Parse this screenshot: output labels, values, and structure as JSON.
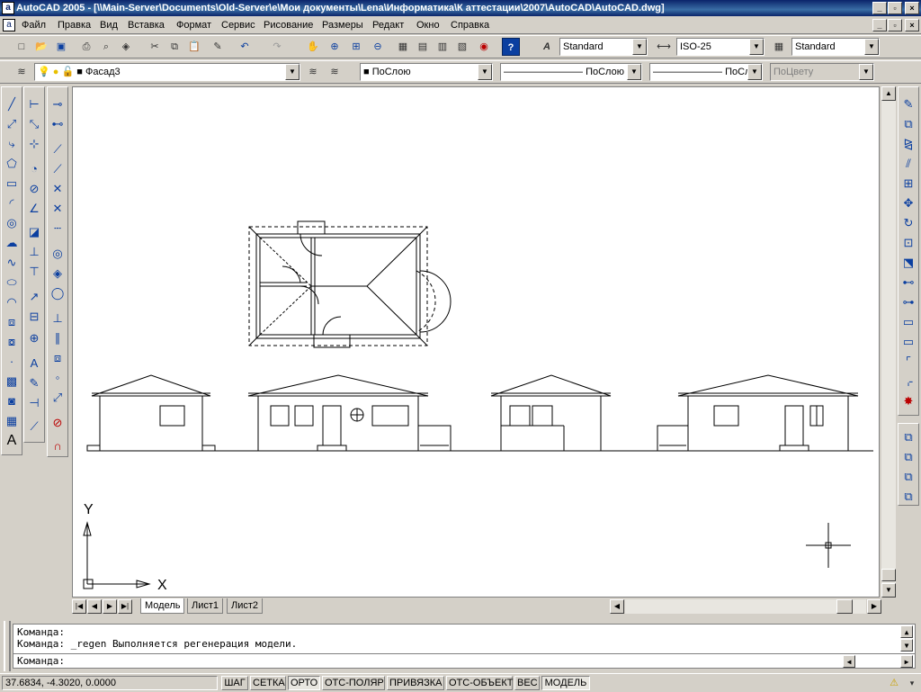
{
  "window": {
    "title": "AutoCAD 2005 - [\\\\Main-Server\\Documents\\Old-Server\\e\\Мои документы\\Lena\\Информатика\\К аттестации\\2007\\AutoCAD\\AutoCAD.dwg]",
    "app_icon": "autocad-icon"
  },
  "menu": [
    "Файл",
    "Правка",
    "Вид",
    "Вставка",
    "Формат",
    "Сервис",
    "Рисование",
    "Размеры",
    "Редакт",
    "Окно",
    "Справка"
  ],
  "toolbar": {
    "text_style": "Standard",
    "dim_style": "ISO-25",
    "table_style": "Standard",
    "layer": "Фасад3",
    "color": "ПоСлою",
    "linetype": "ПоСлою",
    "lineweight": "ПоСлою",
    "plotstyle": "ПоЦвету"
  },
  "canvas": {
    "ucs_x": "X",
    "ucs_y": "Y"
  },
  "tabs": [
    "Модель",
    "Лист1",
    "Лист2"
  ],
  "command": {
    "line1": "Команда:",
    "line2": "Команда: _regen Выполняется регенерация модели.",
    "prompt": "Команда:"
  },
  "status": {
    "coords": "37.6834, -4.3020, 0.0000",
    "buttons": [
      "ШАГ",
      "СЕТКА",
      "ОРТО",
      "ОТС-ПОЛЯР",
      "ПРИВЯЗКА",
      "ОТС-ОБЪЕКТ",
      "ВЕС",
      "МОДЕЛЬ"
    ],
    "active": [
      "ОРТО",
      "МОДЕЛЬ"
    ]
  },
  "colors": {
    "titlebar": "#0a246a",
    "chrome": "#d4d0c8",
    "canvas": "#ffffff"
  }
}
